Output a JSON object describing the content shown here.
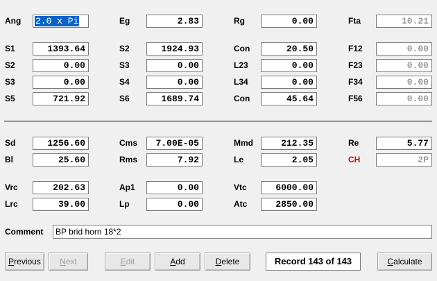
{
  "rows": [
    {
      "key": "ang",
      "label": "Ang",
      "value": "2.0 x Pi"
    },
    {
      "key": "eg",
      "label": "Eg",
      "value": "2.83"
    },
    {
      "key": "rg",
      "label": "Rg",
      "value": "0.00"
    },
    {
      "key": "fta",
      "label": "Fta",
      "value": "10.21"
    },
    {
      "key": "s1",
      "label": "S1",
      "value": "1393.64"
    },
    {
      "key": "s2b",
      "label": "S2",
      "value": "1924.93"
    },
    {
      "key": "con1",
      "label": "Con",
      "value": "20.50"
    },
    {
      "key": "f12",
      "label": "F12",
      "value": "0.00"
    },
    {
      "key": "s2",
      "label": "S2",
      "value": "0.00"
    },
    {
      "key": "s3b",
      "label": "S3",
      "value": "0.00"
    },
    {
      "key": "l23",
      "label": "L23",
      "value": "0.00"
    },
    {
      "key": "f23",
      "label": "F23",
      "value": "0.00"
    },
    {
      "key": "s3",
      "label": "S3",
      "value": "0.00"
    },
    {
      "key": "s4",
      "label": "S4",
      "value": "0.00"
    },
    {
      "key": "l34",
      "label": "L34",
      "value": "0.00"
    },
    {
      "key": "f34",
      "label": "F34",
      "value": "0.00"
    },
    {
      "key": "s5",
      "label": "S5",
      "value": "721.92"
    },
    {
      "key": "s6",
      "label": "S6",
      "value": "1689.74"
    },
    {
      "key": "con2",
      "label": "Con",
      "value": "45.64"
    },
    {
      "key": "f56",
      "label": "F56",
      "value": "0.00"
    },
    {
      "key": "sd",
      "label": "Sd",
      "value": "1256.60"
    },
    {
      "key": "cms",
      "label": "Cms",
      "value": "7.00E-05"
    },
    {
      "key": "mmd",
      "label": "Mmd",
      "value": "212.35"
    },
    {
      "key": "re",
      "label": "Re",
      "value": "5.77"
    },
    {
      "key": "bl",
      "label": "Bl",
      "value": "25.60"
    },
    {
      "key": "rms",
      "label": "Rms",
      "value": "7.92"
    },
    {
      "key": "le",
      "label": "Le",
      "value": "2.05"
    },
    {
      "key": "ch",
      "label": "CH",
      "value": "2P"
    },
    {
      "key": "vrc",
      "label": "Vrc",
      "value": "202.63"
    },
    {
      "key": "ap1",
      "label": "Ap1",
      "value": "0.00"
    },
    {
      "key": "vtc",
      "label": "Vtc",
      "value": "6000.00"
    },
    {
      "key": "lrc",
      "label": "Lrc",
      "value": "39.00"
    },
    {
      "key": "lp",
      "label": "Lp",
      "value": "0.00"
    },
    {
      "key": "atc",
      "label": "Atc",
      "value": "2850.00"
    }
  ],
  "comment": {
    "label": "Comment",
    "value": "BP brid horn 18*2"
  },
  "buttons": {
    "previous": "Previous",
    "next": "Next",
    "edit": "Edit",
    "add": "Add",
    "delete": "Delete",
    "calculate": "Calculate"
  },
  "record_status": "Record 143 of 143",
  "colors": {
    "ch_label": "#d40000",
    "selection": "#0a64c8",
    "readonly_text": "#9a9a9a"
  }
}
